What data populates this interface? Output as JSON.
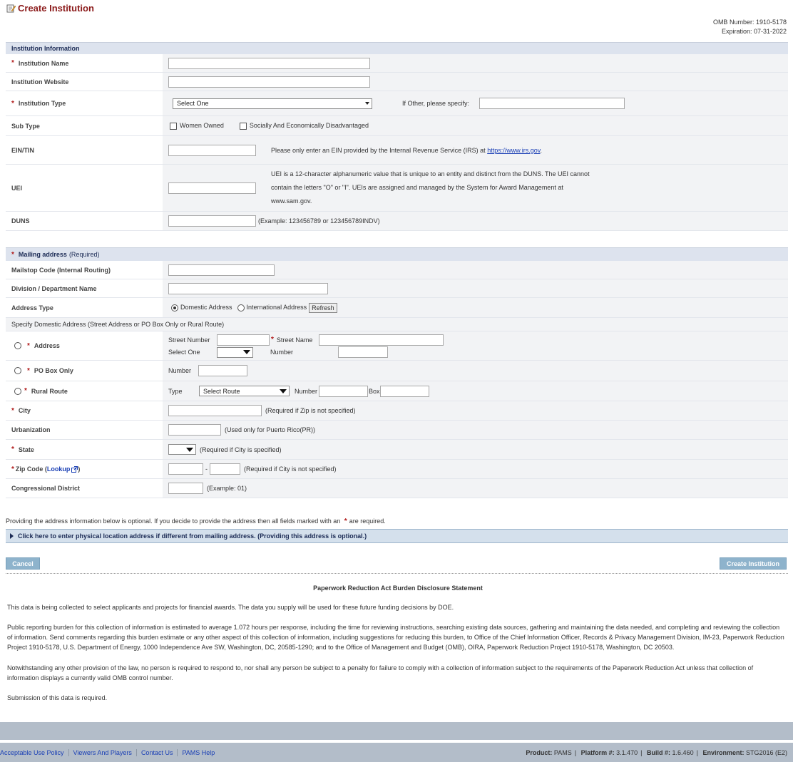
{
  "header": {
    "title": "Create Institution",
    "omb_number": "OMB Number: 1910-5178",
    "expiration": "Expiration: 07-31-2022"
  },
  "institution_info": {
    "section_title": "Institution Information",
    "name_label": "Institution Name",
    "website_label": "Institution Website",
    "type_label": "Institution Type",
    "type_selected": "Select One",
    "other_label": "If Other, please specify:",
    "subtype_label": "Sub Type",
    "subtype_women": "Women Owned",
    "subtype_disadv": "Socially And Economically Disadvantaged",
    "ein_label": "EIN/TIN",
    "ein_note": "Please only enter an EIN provided by the Internal Revenue Service (IRS) at",
    "ein_link": "https://www.irs.gov",
    "ein_note_end": ".",
    "uei_label": "UEI",
    "uei_note_1": "UEI is a 12-character alphanumeric value that is unique to an entity and distinct from the DUNS. The UEI cannot",
    "uei_note_2": "contain the letters \"O\" or \"I\". UEIs are assigned and managed by the System for Award Management at",
    "uei_note_3": "www.sam.gov.",
    "duns_label": "DUNS",
    "duns_note": "(Example: 123456789 or 123456789INDV)"
  },
  "mailing": {
    "section_title": "Mailing address",
    "section_req": "(Required)",
    "mailstop_label": "Mailstop Code (Internal Routing)",
    "division_label": "Division / Department Name",
    "address_type_label": "Address Type",
    "domestic": "Domestic Address",
    "international": "International Address",
    "refresh": "Refresh",
    "specify_note": "Specify Domestic Address (Street Address or PO Box Only or Rural Route)",
    "address_label": "Address",
    "street_number": "Street Number",
    "street_name": "Street Name",
    "select_one": "Select One",
    "number": "Number",
    "po_box_label": "PO Box Only",
    "rural_label": "Rural Route",
    "type": "Type",
    "select_route": "Select Route",
    "box": "Box",
    "city_label": "City",
    "city_note": "(Required if Zip is not specified)",
    "urbanization_label": "Urbanization",
    "urbanization_note": "(Used only for Puerto Rico(PR))",
    "state_label": "State",
    "state_note": "(Required if City is specified)",
    "zip_label": "Zip Code (",
    "zip_lookup": "Lookup",
    "zip_label_end": " )",
    "zip_dash": "-",
    "zip_note": "(Required if City is not specified)",
    "congress_label": "Congressional District",
    "congress_note": "(Example: 01)"
  },
  "optional_note_1": "Providing the address information below is optional. If you decide to provide the address then all fields marked with an",
  "optional_note_2": "are required.",
  "expander_text": "Click here to enter physical location address if different from mailing address. (Providing this address is optional.)",
  "buttons": {
    "cancel": "Cancel",
    "create": "Create Institution"
  },
  "prd": {
    "title": "Paperwork Reduction Act Burden Disclosure Statement",
    "p1": "This data is being collected to select applicants and projects for financial awards. The data you supply will be used for these future funding decisions by DOE.",
    "p2": "Public reporting burden for this collection of information is estimated to average 1.072 hours per response, including the time for reviewing instructions, searching existing data sources, gathering and maintaining the data needed, and completing and reviewing the collection of information. Send comments regarding this burden estimate or any other aspect of this collection of information, including suggestions for reducing this burden, to Office of the Chief Information Officer, Records & Privacy Management Division, IM-23, Paperwork Reduction Project 1910-5178, U.S. Department of Energy, 1000 Independence Ave SW, Washington, DC, 20585-1290; and to the Office of Management and Budget (OMB), OIRA, Paperwork Reduction Project 1910-5178, Washington, DC 20503.",
    "p3": "Notwithstanding any other provision of the law, no person is required to respond to, nor shall any person be subject to a penalty for failure to comply with a collection of information subject to the requirements of the Paperwork Reduction Act unless that collection of information displays a currently valid OMB control number.",
    "p4": "Submission of this data is required."
  },
  "footer": {
    "links": [
      "Acceptable Use Policy",
      "Viewers And Players",
      "Contact Us",
      "PAMS Help"
    ],
    "product_label": "Product:",
    "product": "PAMS",
    "platform_label": "Platform #:",
    "platform": "3.1.470",
    "build_label": "Build #:",
    "build": "1.6.460",
    "env_label": "Environment:",
    "env": "STG2016 (E2)"
  }
}
